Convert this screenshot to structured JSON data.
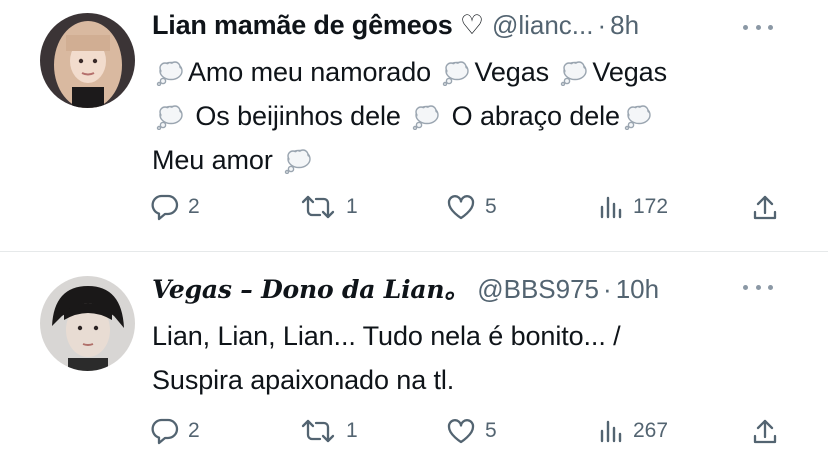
{
  "tweets": [
    {
      "name": "Lian mamãe de gêmeos ♡",
      "handle": "@lianc...",
      "dot": "·",
      "time": "8h",
      "lines": [
        [
          "",
          "Amo meu namorado",
          "Vegas",
          "Vegas"
        ],
        [
          "",
          "Os beijinhos dele",
          "O abraço dele",
          ""
        ],
        [
          "Meu amor",
          ""
        ]
      ],
      "counts": {
        "reply": "2",
        "retweet": "1",
        "like": "5",
        "views": "172"
      }
    },
    {
      "name": "Vegas – Dono da Lian。",
      "handle": "@BBS975",
      "dot": "·",
      "time": "10h",
      "lines": [
        [
          "Lian, Lian, Lian... Tudo nela é bonito... /"
        ],
        [
          "Suspira apaixonado na tl."
        ]
      ],
      "counts": {
        "reply": "2",
        "retweet": "1",
        "like": "5",
        "views": "267"
      }
    }
  ],
  "icons": [
    "thought-balloon-icon",
    "reply-icon",
    "retweet-icon",
    "like-icon",
    "views-icon",
    "share-icon",
    "more-icon"
  ],
  "colors": {
    "text": "#0f1419",
    "secondary": "#536471",
    "divider": "#e6e9ea"
  }
}
